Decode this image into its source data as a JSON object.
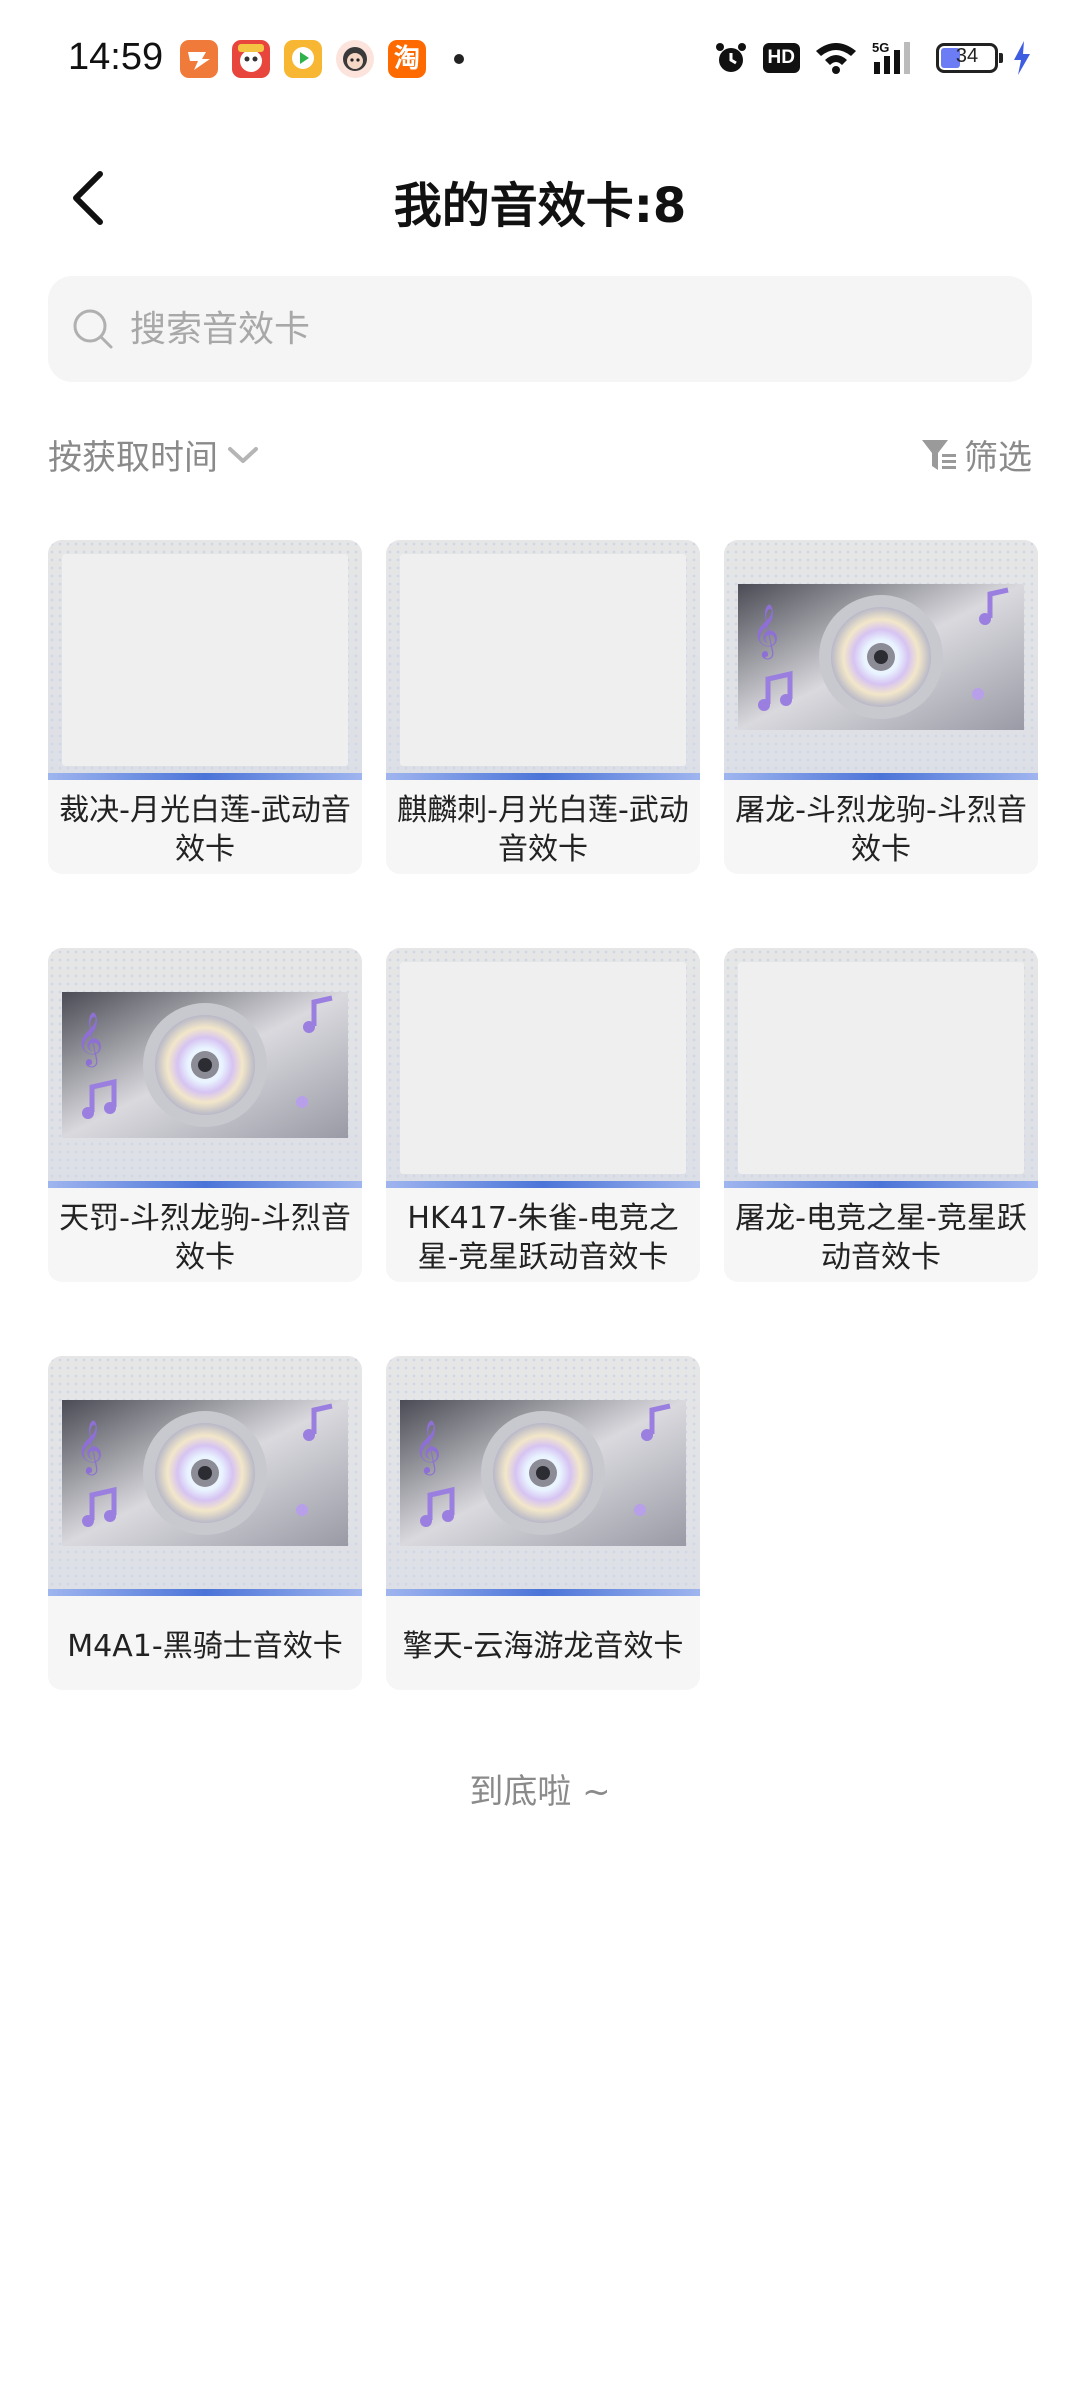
{
  "status_bar": {
    "time": "14:59",
    "taobao_label": "淘",
    "hd_label": "HD",
    "network_label": "5G",
    "battery_level": "34"
  },
  "header": {
    "title": "我的音效卡:8"
  },
  "search": {
    "placeholder": "搜索音效卡"
  },
  "toolbar": {
    "sort_label": "按获取时间",
    "filter_label": "筛选"
  },
  "cards": [
    {
      "label": "裁决-月光白莲-武动音效卡",
      "thumb": "blank"
    },
    {
      "label": "麒麟刺-月光白莲-武动音效卡",
      "thumb": "blank"
    },
    {
      "label": "屠龙-斗烈龙驹-斗烈音效卡",
      "thumb": "cd"
    },
    {
      "label": "天罚-斗烈龙驹-斗烈音效卡",
      "thumb": "cd"
    },
    {
      "label": "HK417-朱雀-电竞之星-竞星跃动音效卡",
      "thumb": "blank"
    },
    {
      "label": "屠龙-电竞之星-竞星跃动音效卡",
      "thumb": "blank"
    },
    {
      "label": "M4A1-黑骑士音效卡",
      "thumb": "cd"
    },
    {
      "label": "擎天-云海游龙音效卡",
      "thumb": "cd"
    }
  ],
  "footer": {
    "end_text": "到底啦 ~"
  },
  "colors": {
    "accent_blue": "#4b74d8",
    "muted_text": "#8a8a8a"
  }
}
